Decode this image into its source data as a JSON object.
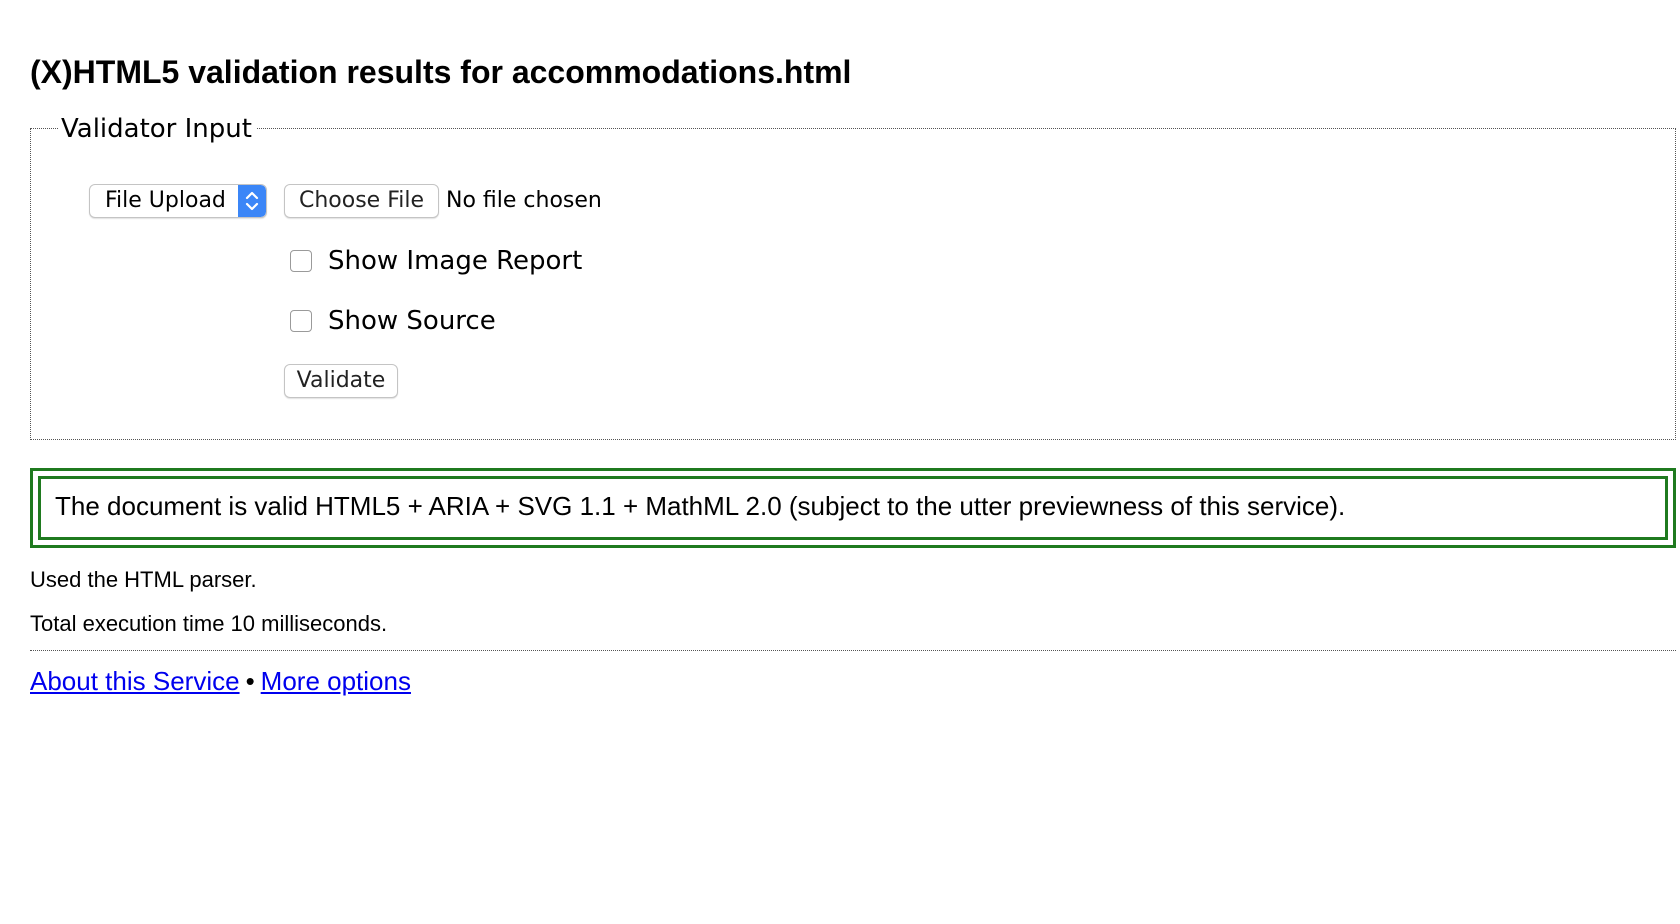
{
  "page": {
    "title": "(X)HTML5 validation results for accommodations.html"
  },
  "validator_input": {
    "legend": "Validator Input",
    "input_mode": {
      "selected": "File Upload"
    },
    "file": {
      "button_label": "Choose File",
      "status": "No file chosen"
    },
    "options": [
      {
        "label": "Show Image Report",
        "checked": false
      },
      {
        "label": "Show Source",
        "checked": false
      }
    ],
    "submit_label": "Validate"
  },
  "result": {
    "message": "The document is valid HTML5 + ARIA + SVG 1.1 + MathML 2.0 (subject to the utter previewness of this service).",
    "border_color": "#1f7a1f"
  },
  "info": {
    "parser": "Used the HTML parser.",
    "execution_time": "Total execution time 10 milliseconds."
  },
  "footer": {
    "about_link": "About this Service",
    "separator": "•",
    "options_link": "More options",
    "link_color": "#0000ee"
  },
  "icons": {
    "select_arrows": "chevron-up-down-icon"
  }
}
